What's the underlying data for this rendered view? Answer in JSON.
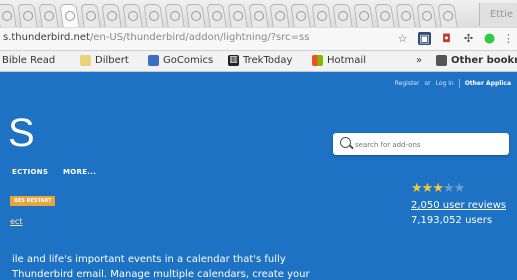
{
  "browser": {
    "window_title": "Ettie",
    "url_domain": "s.thunderbird.net",
    "url_path": "/en-US/thunderbird/addon/lightning/?src=ss",
    "bookmarks": [
      {
        "label": "Bible Read",
        "icon": "bookmark-icon"
      },
      {
        "label": "Dilbert",
        "icon": "bookmark-icon"
      },
      {
        "label": "GoComics",
        "icon": "bookmark-icon"
      },
      {
        "label": "TrekToday",
        "icon": "bookmark-icon"
      },
      {
        "label": "Hotmail",
        "icon": "windows-icon"
      }
    ],
    "overflow_label": "»",
    "other_bookmarks_label": "Other bookmar"
  },
  "header": {
    "register_label": "Register",
    "or_label": "or",
    "login_label": "Log in",
    "other_apps_label": "Other Applica"
  },
  "site": {
    "logo_text": "S",
    "nav": [
      "ECTIONS",
      "MORE..."
    ],
    "search_placeholder": "search for add-ons"
  },
  "addon": {
    "badge": "RES RESTART",
    "compat_link": "ect",
    "rating": 3,
    "rating_max": 5,
    "reviews_label": "2,050 user reviews",
    "users_label": "7,193,052 users",
    "description_line1": "ile and life's important events in a calendar that's fully",
    "description_line2": "Thunderbird email. Manage multiple calendars, create your"
  },
  "colors": {
    "page_bg": "#1d72c4",
    "badge": "#e9a43c",
    "star_on": "#f5c644"
  }
}
